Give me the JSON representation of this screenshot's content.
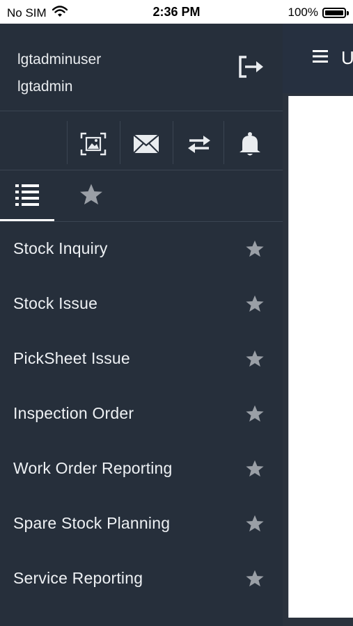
{
  "status_bar": {
    "carrier": "No SIM",
    "time": "2:36 PM",
    "battery": "100%",
    "battery_level": 1.0
  },
  "drawer": {
    "username": "lgtadminuser",
    "role": "lgtadmin",
    "tools": [
      "scan-icon",
      "mail-icon",
      "swap-icon",
      "bell-icon"
    ],
    "tabs": [
      "list-icon",
      "star-icon"
    ],
    "selected_tab": "list-icon",
    "menu_items": [
      {
        "label": "Stock Inquiry"
      },
      {
        "label": "Stock Issue"
      },
      {
        "label": "PickSheet Issue"
      },
      {
        "label": "Inspection Order"
      },
      {
        "label": "Work Order Reporting"
      },
      {
        "label": "Spare Stock Planning"
      },
      {
        "label": "Service Reporting"
      }
    ]
  },
  "main": {
    "title_peek": "U"
  },
  "colors": {
    "drawer_bg": "#262f3b",
    "separator": "#3b4552",
    "text": "#eef1f4",
    "star_grey": "#9a9fa6"
  }
}
